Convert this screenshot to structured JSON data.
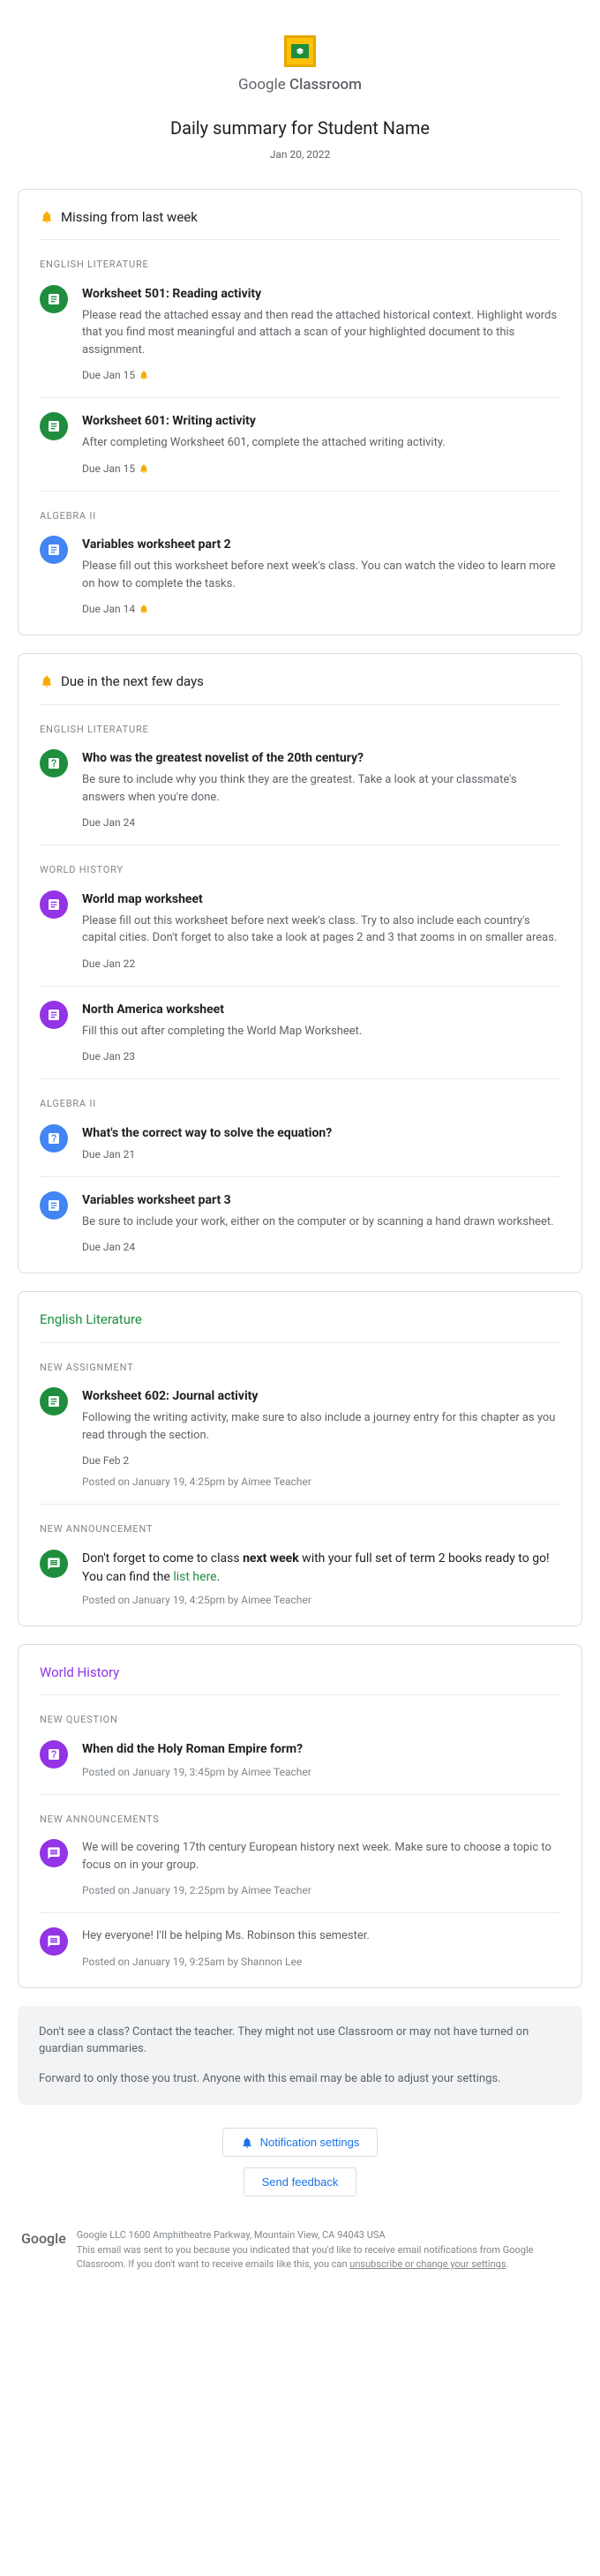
{
  "brand": {
    "name1": "Google",
    "name2": "Classroom"
  },
  "title": "Daily summary for Student Name",
  "date": "Jan 20, 2022",
  "missing": {
    "heading": "Missing from last week",
    "groups": [
      {
        "label": "ENGLISH LITERATURE",
        "color": "green",
        "items": [
          {
            "icon": "doc",
            "title": "Worksheet 501: Reading activity",
            "desc": "Please read the attached essay and then read the attached historical context. Highlight words that you find most meaningful and attach a scan of your highlighted document to this assignment.",
            "due": "Due Jan 15",
            "alert": true
          },
          {
            "icon": "doc",
            "title": "Worksheet 601: Writing activity",
            "desc": "After completing Worksheet 601, complete the attached writing activity.",
            "due": "Due Jan 15",
            "alert": true
          }
        ]
      },
      {
        "label": "ALGEBRA II",
        "color": "blue",
        "items": [
          {
            "icon": "doc",
            "title": "Variables worksheet part 2",
            "desc": "Please fill out this worksheet before next week's class. You can watch the video to learn more on how to complete the tasks.",
            "due": "Due Jan 14",
            "alert": true
          }
        ]
      }
    ]
  },
  "upcoming": {
    "heading": "Due in the next few days",
    "groups": [
      {
        "label": "ENGLISH LITERATURE",
        "color": "green",
        "items": [
          {
            "icon": "question",
            "title": "Who was the greatest novelist of the 20th century?",
            "desc": "Be sure to include why you think they are the greatest. Take a look at your classmate's answers when you're done.",
            "due": "Due Jan 24"
          }
        ]
      },
      {
        "label": "WORLD HISTORY",
        "color": "purple",
        "items": [
          {
            "icon": "doc",
            "title": "World map worksheet",
            "desc": "Please fill out this worksheet before next week's class. Try to also include each country's capital cities. Don't forget to also take a look at pages 2 and 3 that zooms in on smaller areas.",
            "due": "Due Jan 22"
          },
          {
            "icon": "doc",
            "title": "North America worksheet",
            "desc": "Fill this out after completing the World Map Worksheet.",
            "due": "Due Jan 23"
          }
        ]
      },
      {
        "label": "ALGEBRA II",
        "color": "blue",
        "items": [
          {
            "icon": "question",
            "title": "What's the correct way to solve the equation?",
            "due": "Due Jan 21"
          },
          {
            "icon": "doc",
            "title": "Variables worksheet part 3",
            "desc": "Be sure to include your work, either on the computer or by scanning a hand drawn worksheet.",
            "due": "Due Jan 24"
          }
        ]
      }
    ]
  },
  "english": {
    "heading": "English Literature",
    "groups": [
      {
        "label": "NEW ASSIGNMENT",
        "color": "green",
        "items": [
          {
            "icon": "doc",
            "title": "Worksheet 602: Journal activity",
            "desc": "Following the writing activity, make sure to also include a journey entry for this chapter as you read through the section.",
            "due": "Due Feb 2",
            "posted": "Posted on January 19, 4:25pm by Aimee Teacher"
          }
        ]
      },
      {
        "label": "NEW ANNOUNCEMENT",
        "color": "green",
        "items": [
          {
            "icon": "chat",
            "descHtml": "Don't forget to come to class <b>next week</b> with your full set of term 2 books ready to go! You can find the <a class='link' href='#'>list here</a>.",
            "posted": "Posted on January 19, 4:25pm by Aimee Teacher"
          }
        ]
      }
    ]
  },
  "history": {
    "heading": "World History",
    "groups": [
      {
        "label": "NEW QUESTION",
        "color": "purple",
        "items": [
          {
            "icon": "question",
            "title": "When did the Holy Roman Empire form?",
            "posted": "Posted on January 19, 3:45pm by Aimee Teacher"
          }
        ]
      },
      {
        "label": "NEW ANNOUNCEMENTS",
        "color": "purple",
        "items": [
          {
            "icon": "chat",
            "desc": "We will be covering 17th century European history next week. Make sure to choose a topic to focus on in your group.",
            "posted": "Posted on January 19, 2:25pm by Aimee Teacher"
          },
          {
            "icon": "chat",
            "desc": "Hey everyone! I'll be helping Ms. Robinson this semester.",
            "posted": "Posted on January 19, 9:25am by Shannon Lee"
          }
        ]
      }
    ]
  },
  "info": {
    "p1": "Don't see a class? Contact the teacher. They might not use Classroom or may not have turned on guardian summaries.",
    "p2": "Forward to only those you trust. Anyone with this email may be able to adjust your settings."
  },
  "actions": {
    "notif": "Notification settings",
    "feedback": "Send feedback"
  },
  "footer": {
    "logo": "Google",
    "addr": "Google LLC 1600 Amphitheatre Parkway, Mountain View, CA 94043 USA",
    "disclaim": "This email was sent to you because you indicated that you'd like to receive email notifications from Google Classroom. If you don't want to receive emails like this, you can ",
    "link": "unsubscribe or change your settings"
  }
}
